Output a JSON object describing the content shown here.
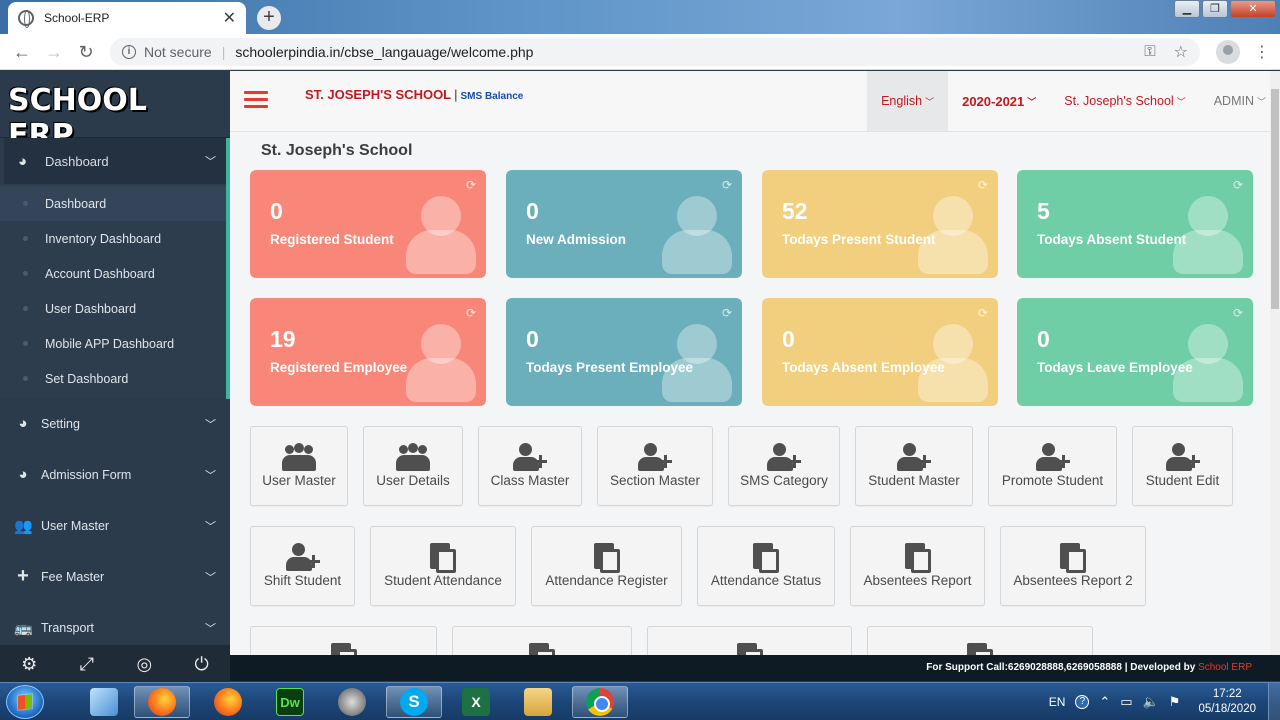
{
  "browser": {
    "tab_title": "School-ERP",
    "security": "Not secure",
    "url": "schoolerpindia.in/cbse_langauage/welcome.php"
  },
  "sidebar": {
    "logo": "SCHOOL ERP",
    "dashboard_group": {
      "label": "Dashboard",
      "items": [
        {
          "label": "Dashboard"
        },
        {
          "label": "Inventory Dashboard"
        },
        {
          "label": "Account Dashboard"
        },
        {
          "label": "User Dashboard"
        },
        {
          "label": "Mobile APP Dashboard"
        },
        {
          "label": "Set Dashboard"
        }
      ]
    },
    "menu": [
      {
        "label": "Setting",
        "icon": "dashboard-gauge-icon"
      },
      {
        "label": "Admission Form",
        "icon": "dashboard-gauge-icon"
      },
      {
        "label": "User Master",
        "icon": "users-icon"
      },
      {
        "label": "Fee Master",
        "icon": "plus-icon"
      },
      {
        "label": "Transport",
        "icon": "bus-icon"
      }
    ]
  },
  "header": {
    "school_name": "ST. JOSEPH'S SCHOOL",
    "separator": "|",
    "sms_balance": "SMS Balance",
    "language": "English",
    "session": "2020-2021",
    "school_select": "St. Joseph's School",
    "user": "ADMIN"
  },
  "main": {
    "page_title": "St. Joseph's School",
    "stats": [
      {
        "value": "0",
        "label": "Registered Student",
        "color": "#f8877a"
      },
      {
        "value": "0",
        "label": "New Admission",
        "color": "#6aafbb"
      },
      {
        "value": "52",
        "label": "Todays Present Student",
        "color": "#f2cf7f"
      },
      {
        "value": "5",
        "label": "Todays Absent Student",
        "color": "#6fcea6"
      },
      {
        "value": "19",
        "label": "Registered Employee",
        "color": "#f8877a"
      },
      {
        "value": "0",
        "label": "Todays Present Employee",
        "color": "#6aafbb"
      },
      {
        "value": "0",
        "label": "Todays Absent Employee",
        "color": "#f2cf7f"
      },
      {
        "value": "0",
        "label": "Todays Leave Employee",
        "color": "#6fcea6"
      }
    ],
    "tiles_row1": [
      {
        "label": "User Master",
        "icon": "users-group-icon"
      },
      {
        "label": "User Details",
        "icon": "users-group-icon"
      },
      {
        "label": "Class Master",
        "icon": "user-plus-icon"
      },
      {
        "label": "Section Master",
        "icon": "user-plus-icon"
      },
      {
        "label": "SMS Category",
        "icon": "user-plus-icon"
      },
      {
        "label": "Student Master",
        "icon": "user-plus-icon"
      },
      {
        "label": "Promote Student",
        "icon": "user-plus-icon"
      },
      {
        "label": "Student Edit",
        "icon": "user-plus-icon"
      }
    ],
    "tiles_row2": [
      {
        "label": "Shift Student",
        "icon": "user-plus-icon"
      },
      {
        "label": "Student Attendance",
        "icon": "copy-file-icon"
      },
      {
        "label": "Attendance Register",
        "icon": "copy-file-icon"
      },
      {
        "label": "Attendance Status",
        "icon": "copy-file-icon"
      },
      {
        "label": "Absentees Report",
        "icon": "copy-file-icon"
      },
      {
        "label": "Absentees Report 2",
        "icon": "copy-file-icon"
      }
    ]
  },
  "footer": {
    "support": "For Support Call:6269028888,6269058888 | Developed by",
    "developer": "School ERP"
  },
  "taskbar": {
    "apps": [
      "Windows Explorer",
      "Firefox",
      "Firefox",
      "Dw",
      "Image Viewer",
      "S",
      "X",
      "Folder",
      "Chrome"
    ],
    "lang": "EN",
    "time": "17:22",
    "date": "05/18/2020"
  }
}
